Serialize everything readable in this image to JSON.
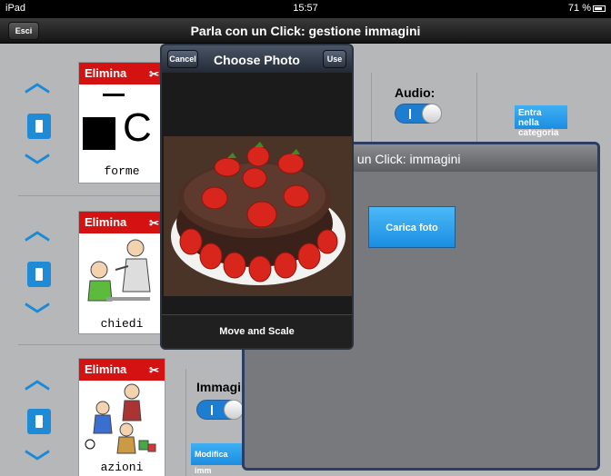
{
  "statusbar": {
    "device": "iPad",
    "time": "15:57",
    "battery": "71 %"
  },
  "titlebar": {
    "title": "Parla con un Click: gestione immagini",
    "esc_label": "Esci"
  },
  "rows": [
    {
      "delete_label": "Elimina",
      "image_label": "forme"
    },
    {
      "delete_label": "Elimina",
      "image_label": "chiedi"
    },
    {
      "delete_label": "Elimina",
      "image_label": "azioni"
    }
  ],
  "row1_controls": {
    "audio_label": "Audio:",
    "enter_category_label": "Entra nella categoria"
  },
  "row3_controls": {
    "image_label": "Immagin",
    "edit_label": "Modifica imm"
  },
  "choose_photo": {
    "title": "Choose Photo",
    "cancel_label": "Cancel",
    "use_label": "Use",
    "bottom_label": "Move and Scale"
  },
  "images_panel": {
    "title": "rla con un Click: immagini",
    "upload_label": "Carica foto"
  },
  "colors": {
    "accent_blue": "#1f8bd6",
    "delete_red": "#d51212",
    "toggle_blue": "#1d7ed1"
  }
}
